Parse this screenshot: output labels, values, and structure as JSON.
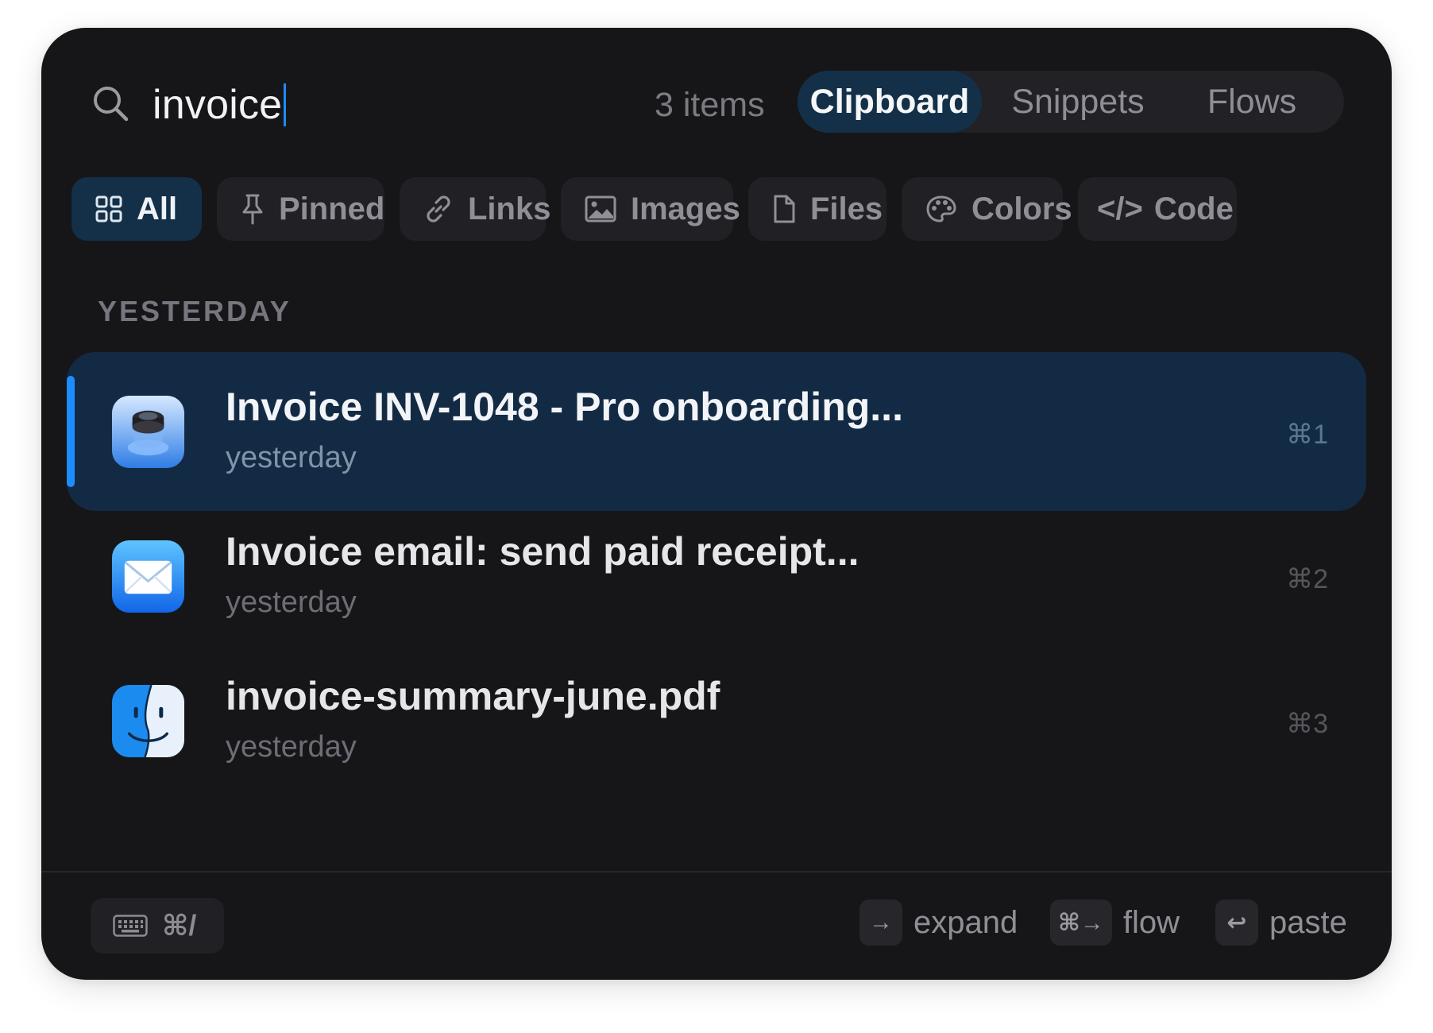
{
  "search": {
    "query": "invoice",
    "count_label": "3 items"
  },
  "modes": [
    {
      "label": "Clipboard",
      "active": true
    },
    {
      "label": "Snippets",
      "active": false
    },
    {
      "label": "Flows",
      "active": false
    }
  ],
  "filters": [
    {
      "label": "All",
      "icon": "grid-icon",
      "active": true
    },
    {
      "label": "Pinned",
      "icon": "pin-icon"
    },
    {
      "label": "Links",
      "icon": "link-icon"
    },
    {
      "label": "Images",
      "icon": "image-icon"
    },
    {
      "label": "Files",
      "icon": "file-icon"
    },
    {
      "label": "Colors",
      "icon": "palette-icon"
    },
    {
      "label": "Code",
      "icon": "code-icon",
      "icon_text": "</>"
    }
  ],
  "section_label": "YESTERDAY",
  "items": [
    {
      "title": "Invoice INV-1048 - Pro onboarding...",
      "time": "yesterday",
      "shortcut": "⌘1",
      "app_icon": "preview-app-icon",
      "selected": true
    },
    {
      "title": "Invoice email: send paid receipt...",
      "time": "yesterday",
      "shortcut": "⌘2",
      "app_icon": "mail-app-icon",
      "selected": false
    },
    {
      "title": "invoice-summary-june.pdf",
      "time": "yesterday",
      "shortcut": "⌘3",
      "app_icon": "finder-app-icon",
      "selected": false
    }
  ],
  "footer": {
    "keyboard_shortcut": "⌘/",
    "hints": [
      {
        "key": "→",
        "label": "expand"
      },
      {
        "key": "⌘→",
        "label": "flow"
      },
      {
        "key": "↩",
        "label": "paste"
      }
    ]
  },
  "colors": {
    "accent": "#1c8cff",
    "selected_bg": "#133048",
    "window_bg": "#161619"
  }
}
